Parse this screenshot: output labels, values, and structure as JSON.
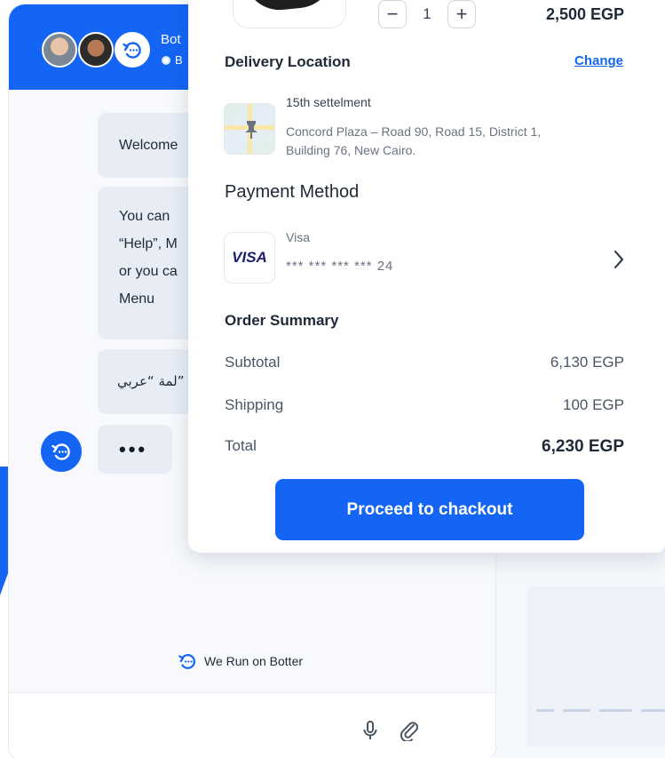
{
  "chat": {
    "bot_name": "Bot",
    "bot_status": "B",
    "messages": [
      {
        "text": "Welcome"
      },
      {
        "lines": [
          "You can",
          "“Help”, M",
          "or you ca",
          "Menu"
        ]
      },
      {
        "text": "لمة “عربي”"
      }
    ],
    "typing": "•••",
    "powered_by": "We Run on Botter"
  },
  "order": {
    "quantity": "1",
    "decrement": "−",
    "increment": "+",
    "line_price": "2,500 EGP",
    "delivery": {
      "title": "Delivery Location",
      "change_label": "Change",
      "location_name": "15th settelment",
      "address": "Concord Plaza – Road 90, Road 15, District 1, Building 76, New Cairo."
    },
    "payment": {
      "title": "Payment Method",
      "card_brand": "VISA",
      "card_name": "Visa",
      "card_number": "*** *** *** *** 24"
    },
    "summary": {
      "title": "Order Summary",
      "rows": [
        {
          "label": "Subtotal",
          "value": "6,130 EGP"
        },
        {
          "label": "Shipping",
          "value": "100 EGP"
        },
        {
          "label": "Total",
          "value": "6,230 EGP"
        }
      ]
    },
    "cta_label": "Proceed to chackout"
  },
  "colors": {
    "primary": "#1565f5",
    "bubble": "#e8edf5",
    "visa": "#1a1f71"
  },
  "icons": [
    "bot-logo-icon",
    "status-dot-icon",
    "mic-icon",
    "paperclip-icon",
    "chevron-right-icon",
    "map-pin-icon"
  ]
}
